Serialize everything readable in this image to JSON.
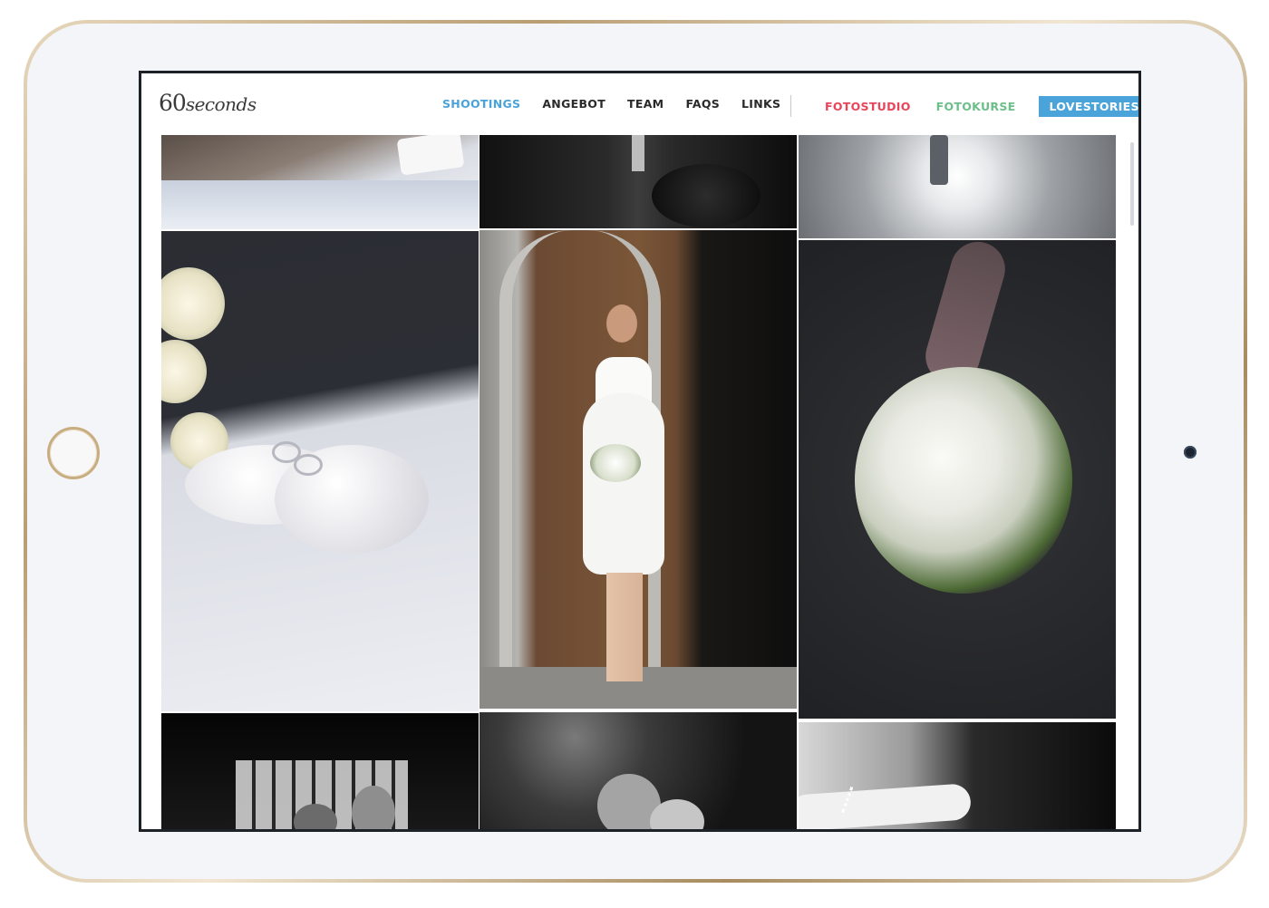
{
  "site": {
    "logo_num": "60",
    "logo_word": "seconds"
  },
  "nav": {
    "items": [
      "SHOOTINGS",
      "ANGEBOT",
      "TEAM",
      "FAQS",
      "LINKS"
    ],
    "active_index": 0,
    "right_items": [
      {
        "label": "FOTOSTUDIO",
        "color": "#e8455a"
      },
      {
        "label": "FOTOKURSE",
        "color": "#6dbf8a"
      },
      {
        "label": "LOVESTORIES",
        "color": "#4aa3d9",
        "active": true
      }
    ]
  },
  "colors": {
    "accent_blue": "#4aa3d9",
    "nav_text": "#2a2a2a",
    "fotostudio": "#e8455a",
    "fotokurse": "#6dbf8a"
  },
  "gallery": {
    "photos": [
      {
        "name": "photo-groom-hand-glove",
        "icon": "image-icon"
      },
      {
        "name": "photo-groom-suit",
        "icon": "image-icon"
      },
      {
        "name": "photo-light-bokeh",
        "icon": "image-icon"
      },
      {
        "name": "photo-rings-pillow",
        "icon": "image-icon"
      },
      {
        "name": "photo-bride-doorway",
        "icon": "image-icon"
      },
      {
        "name": "photo-bridal-bouquet",
        "icon": "image-icon"
      },
      {
        "name": "photo-bw-guests",
        "icon": "image-icon"
      },
      {
        "name": "photo-bw-couple",
        "icon": "image-icon"
      },
      {
        "name": "photo-bw-bracelet",
        "icon": "image-icon"
      }
    ]
  },
  "device": {
    "frame_color": "#c8ad80",
    "screen_bg": "#ffffff"
  }
}
